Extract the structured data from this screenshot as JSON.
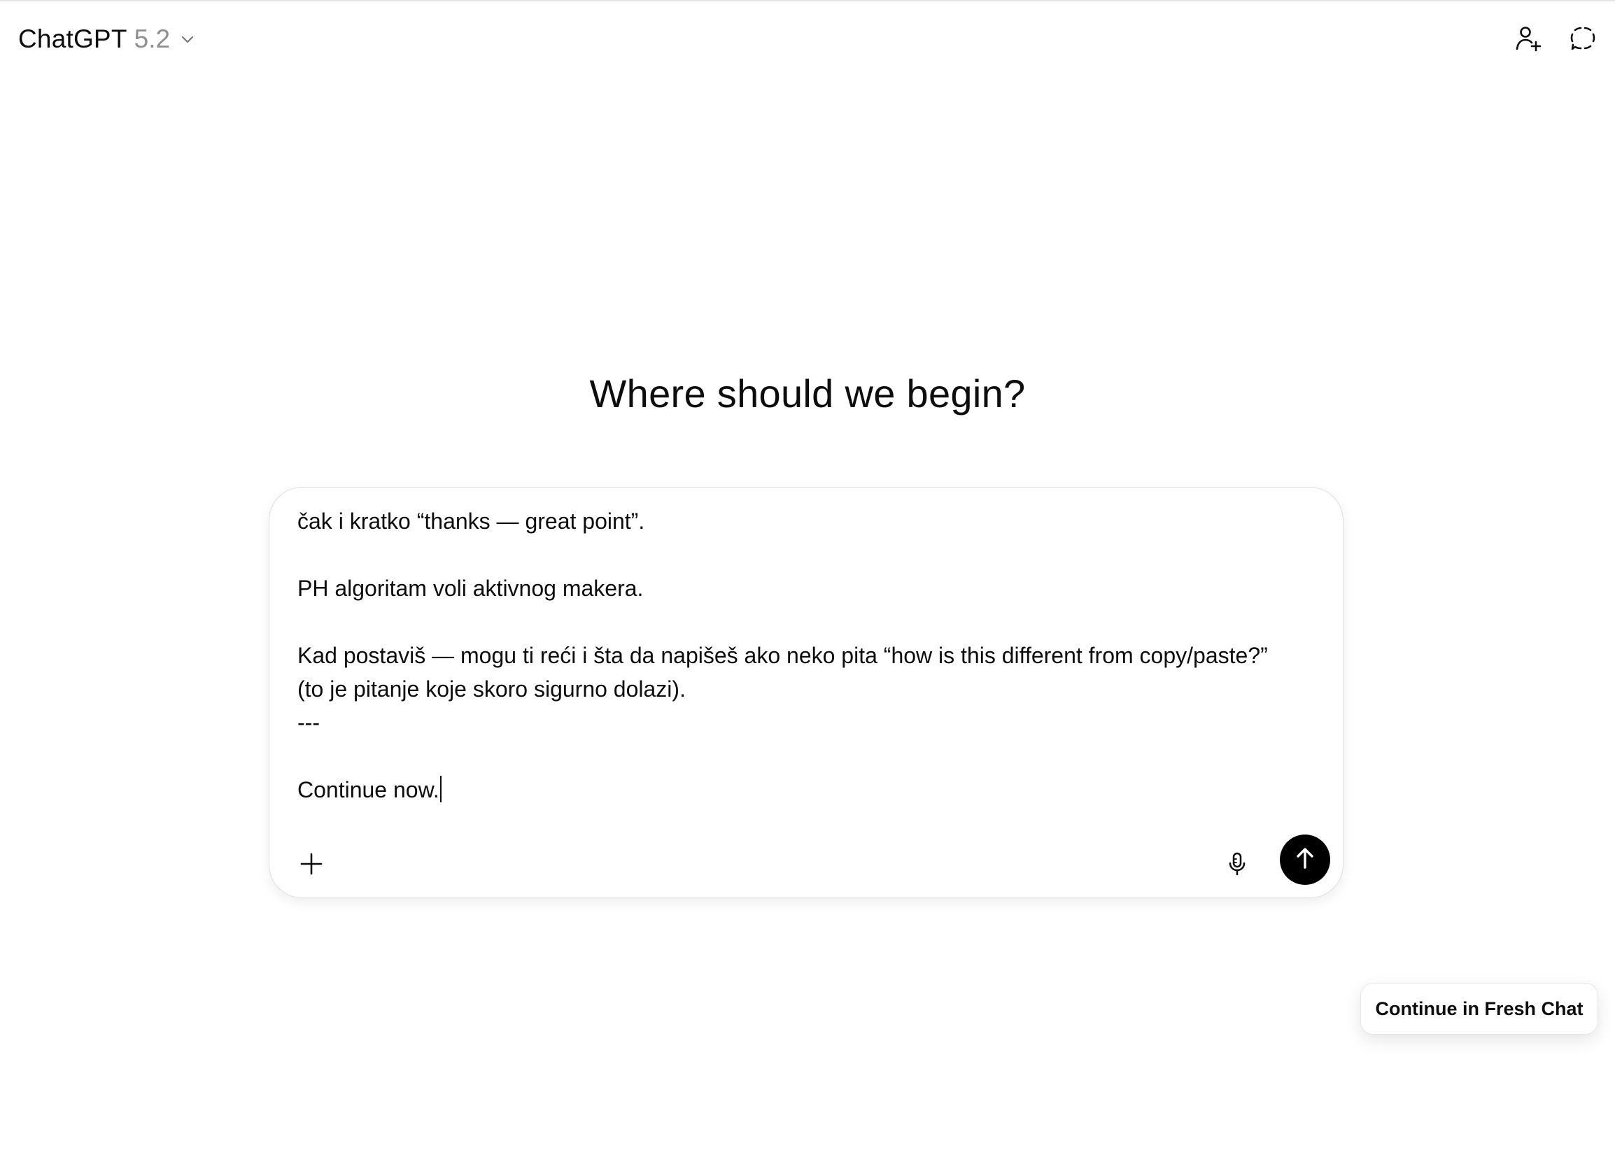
{
  "header": {
    "model_name": "ChatGPT",
    "model_version": "5.2",
    "chevron_icon": "chevron-down-icon",
    "add_people_icon": "person-plus-icon",
    "temporary_chat_icon": "dashed-circle-chat-icon"
  },
  "main": {
    "greeting": "Where should we begin?"
  },
  "composer": {
    "lines": [
      "čak i kratko “thanks — great point”.",
      "",
      "PH algoritam voli aktivnog makera.",
      "",
      "Kad postaviš — mogu ti reći i šta da napišeš ako neko pita “how is this different from copy/paste?”",
      "(to je pitanje koje skoro sigurno dolazi).",
      "---",
      "",
      "Continue now."
    ],
    "plus_icon": "plus-icon",
    "mic_icon": "microphone-icon",
    "send_icon": "arrow-up-icon"
  },
  "floating": {
    "fresh_chat_label": "Continue in Fresh Chat"
  },
  "colors": {
    "text": "#0d0d0d",
    "muted": "#8f8f8f",
    "border": "#dedede",
    "send_button": "#000000"
  }
}
